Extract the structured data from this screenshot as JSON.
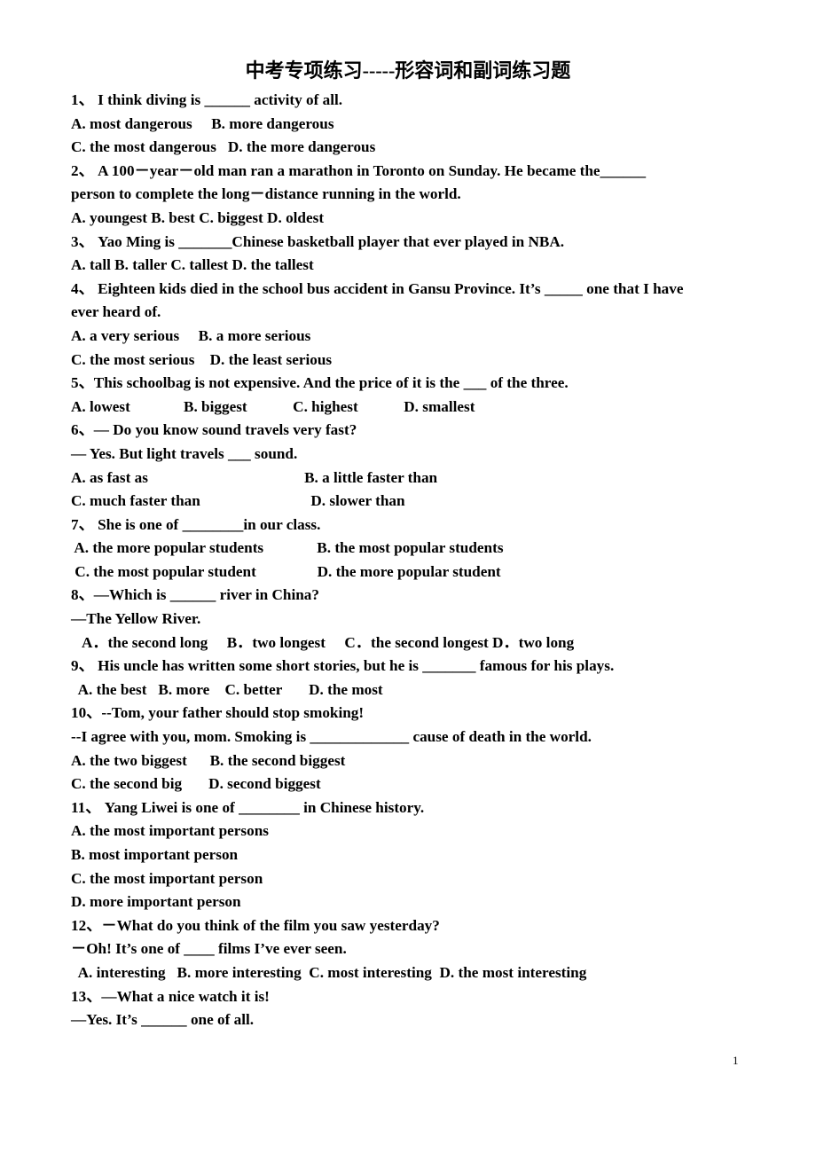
{
  "document": {
    "title": "中考专项练习-----形容词和副词练习题",
    "page_number": "1"
  },
  "lines": [
    {
      "id": "q1-stem",
      "text": "1、 I think diving is ______ activity of all."
    },
    {
      "id": "q1-opt-ab",
      "text": "A. most dangerous     B. more dangerous"
    },
    {
      "id": "q1-opt-cd",
      "text": "C. the most dangerous   D. the more dangerous"
    },
    {
      "id": "q2-stem-1",
      "text": "2、 A 100－year－old man ran a marathon in Toronto on Sunday. He became the______"
    },
    {
      "id": "q2-stem-2",
      "text": "person to complete the long－distance running in the world."
    },
    {
      "id": "q2-opt",
      "text": "A. youngest B. best C. biggest D. oldest"
    },
    {
      "id": "q3-stem",
      "text": "3、 Yao Ming is _______Chinese basketball player that ever played in NBA."
    },
    {
      "id": "q3-opt",
      "text": "A. tall B. taller C. tallest D. the tallest"
    },
    {
      "id": "q4-stem-1",
      "text": "4、 Eighteen kids died in the school bus accident in Gansu Province. It’s _____ one that I have"
    },
    {
      "id": "q4-stem-2",
      "text": "ever heard of."
    },
    {
      "id": "q4-opt-ab",
      "text": "A. a very serious     B. a more serious"
    },
    {
      "id": "q4-opt-cd",
      "text": "C. the most serious    D. the least serious"
    },
    {
      "id": "q5-stem",
      "text": "5、This schoolbag is not expensive. And the price of it is the ___ of the three."
    },
    {
      "id": "q5-opt",
      "text": "A. lowest              B. biggest            C. highest            D. smallest"
    },
    {
      "id": "q6-stem-1",
      "text": "6、— Do you know sound travels very fast?"
    },
    {
      "id": "q6-stem-2",
      "text": "— Yes. But light travels ___ sound."
    },
    {
      "id": "q6-opt-ab",
      "text": "A. as fast as                                         B. a little faster than"
    },
    {
      "id": "q6-opt-cd",
      "text": "C. much faster than                             D. slower than"
    },
    {
      "id": "q7-stem",
      "text": "7、 She is one of ________in our class."
    },
    {
      "id": "q7-opt-ab",
      "text": " A. the more popular students              B. the most popular students"
    },
    {
      "id": "q7-opt-cd",
      "text": " C. the most popular student                D. the more popular student"
    },
    {
      "id": "q8-stem-1",
      "text": "8、—Which is ______ river in China?"
    },
    {
      "id": "q8-stem-2",
      "text": "—The Yellow River."
    },
    {
      "id": "q8-opt",
      "text": "   A．the second long     B．two longest     C．the second longest D．two long"
    },
    {
      "id": "q9-stem",
      "text": "9、 His uncle has written some short stories, but he is _______ famous for his plays."
    },
    {
      "id": "q9-opt",
      "text": "  A. the best   B. more    C. better       D. the most"
    },
    {
      "id": "q10-stem-1",
      "text": "10、--Tom, your father should stop smoking!"
    },
    {
      "id": "q10-stem-2",
      "text": "--I agree with you, mom. Smoking is _____________ cause of death in the world."
    },
    {
      "id": "q10-opt-ab",
      "text": "A. the two biggest      B. the second biggest"
    },
    {
      "id": "q10-opt-cd",
      "text": "C. the second big       D. second biggest"
    },
    {
      "id": "q11-stem",
      "text": "11、 Yang Liwei is one of ________ in Chinese history."
    },
    {
      "id": "q11-opt-a",
      "text": "A. the most important persons"
    },
    {
      "id": "q11-opt-b",
      "text": "B. most important person"
    },
    {
      "id": "q11-opt-c",
      "text": "C. the most important person"
    },
    {
      "id": "q11-opt-d",
      "text": "D. more important person"
    },
    {
      "id": "q12-stem-1",
      "text": "12、－What do you think of the film you saw yesterday?"
    },
    {
      "id": "q12-stem-2",
      "text": "－Oh! It’s one of ____ films I’ve ever seen."
    },
    {
      "id": "q12-opt",
      "text": "  A. interesting   B. more interesting  C. most interesting  D. the most interesting"
    },
    {
      "id": "q13-stem-1",
      "text": "13、—What a nice watch it is!"
    },
    {
      "id": "q13-stem-2",
      "text": "—Yes. It’s ______ one of all."
    }
  ]
}
